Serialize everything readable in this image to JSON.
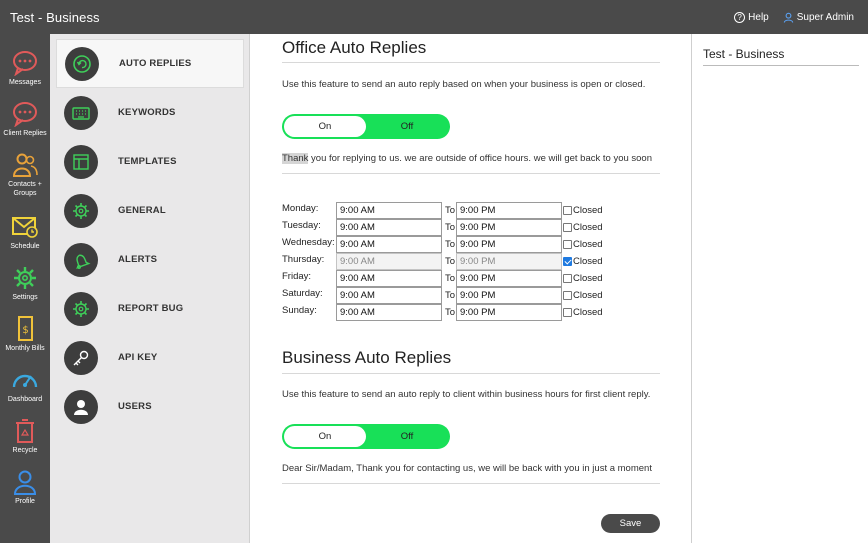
{
  "app": {
    "title": "Test - Business"
  },
  "header": {
    "help_label": "Help",
    "user_label": "Super Admin"
  },
  "rail": [
    {
      "label": "Messages",
      "icon": "messages-icon"
    },
    {
      "label": "Client Replies",
      "icon": "client-replies-icon"
    },
    {
      "label": "Contacts + Groups",
      "icon": "contacts-icon"
    },
    {
      "label": "Schedule",
      "icon": "schedule-icon"
    },
    {
      "label": "Settings",
      "icon": "settings-icon"
    },
    {
      "label": "Monthly Bills",
      "icon": "bills-icon"
    },
    {
      "label": "Dashboard",
      "icon": "dashboard-icon"
    },
    {
      "label": "Recycle",
      "icon": "recycle-icon"
    },
    {
      "label": "Profile",
      "icon": "profile-icon"
    }
  ],
  "menu": [
    {
      "label": "AUTO REPLIES",
      "icon": "auto-reply-icon",
      "active": true
    },
    {
      "label": "KEYWORDS",
      "icon": "keyboard-icon"
    },
    {
      "label": "TEMPLATES",
      "icon": "template-icon"
    },
    {
      "label": "GENERAL",
      "icon": "gear-icon"
    },
    {
      "label": "ALERTS",
      "icon": "bell-icon"
    },
    {
      "label": "REPORT BUG",
      "icon": "bug-gear-icon"
    },
    {
      "label": "API KEY",
      "icon": "key-icon"
    },
    {
      "label": "USERS",
      "icon": "user-icon"
    }
  ],
  "office": {
    "title": "Office Auto Replies",
    "description": "Use this feature to send an auto reply based on when your business is open or closed.",
    "toggle_on": "On",
    "toggle_off": "Off",
    "message_highlight": "Thank",
    "message_rest": " you for replying to us. we are outside of office hours. we will get back to you soon",
    "to_label": "To",
    "closed_label": "Closed",
    "schedule": [
      {
        "day": "Monday:",
        "from": "9:00 AM",
        "to": "9:00 PM",
        "closed": false
      },
      {
        "day": "Tuesday:",
        "from": "9:00 AM",
        "to": "9:00 PM",
        "closed": false
      },
      {
        "day": "Wednesday:",
        "from": "9:00 AM",
        "to": "9:00 PM",
        "closed": false
      },
      {
        "day": "Thursday:",
        "from": "9:00 AM",
        "to": "9:00 PM",
        "closed": true
      },
      {
        "day": "Friday:",
        "from": "9:00 AM",
        "to": "9:00 PM",
        "closed": false
      },
      {
        "day": "Saturday:",
        "from": "9:00 AM",
        "to": "9:00 PM",
        "closed": false
      },
      {
        "day": "Sunday:",
        "from": "9:00 AM",
        "to": "9:00 PM",
        "closed": false
      }
    ]
  },
  "business": {
    "title": "Business Auto Replies",
    "description": "Use this feature to send an auto reply to client within business hours for first client reply.",
    "toggle_on": "On",
    "toggle_off": "Off",
    "message": "Dear Sir/Madam, Thank you for contacting us, we will be back with you in just a moment"
  },
  "save_label": "Save",
  "right_panel": {
    "title": "Test - Business"
  },
  "colors": {
    "toggle_green": "#18e058",
    "dark_bar": "#4a4a4a",
    "rail_accent": "#e05a5a"
  }
}
